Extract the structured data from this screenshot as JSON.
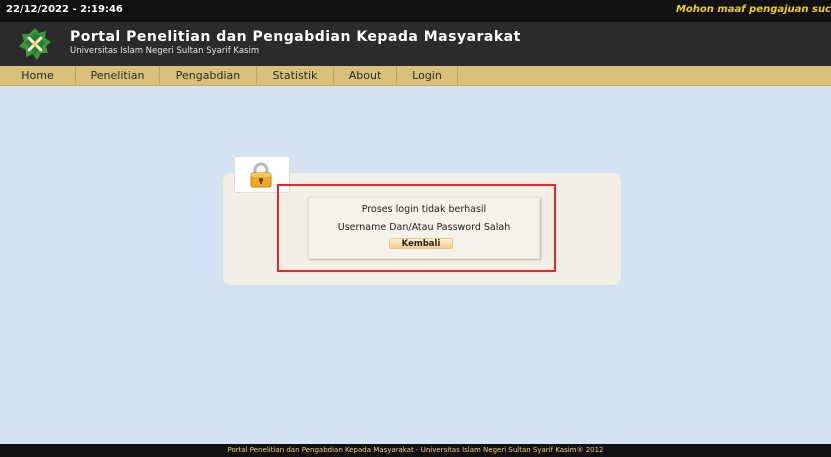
{
  "topbar": {
    "datetime": "22/12/2022 - 2:19:46",
    "marquee": "Mohon maaf pengajuan suc"
  },
  "header": {
    "title": "Portal Penelitian dan Pengabdian Kepada Masyarakat",
    "subtitle": "Universitas Islam Negeri Sultan Syarif Kasim",
    "logo_icon": "uin-suska-logo-icon"
  },
  "nav": {
    "items": [
      {
        "label": "Home"
      },
      {
        "label": "Penelitian"
      },
      {
        "label": "Pengabdian"
      },
      {
        "label": "Statistik"
      },
      {
        "label": "About"
      },
      {
        "label": "Login"
      }
    ]
  },
  "login_result": {
    "icon": "padlock-icon",
    "message": "Proses login tidak berhasil",
    "detail": "Username Dan/Atau Password Salah",
    "back_button": "Kembali"
  },
  "footer": {
    "text": "Portal Penelitian dan Pengabdian Kepada Masyarakat - Universitas Islam Negeri Sultan Syarif Kasim® 2012"
  },
  "colors": {
    "topbar": "#111111",
    "header": "#2b2b2b",
    "nav": "#d8c07a",
    "content_background": "#d3e3f1",
    "marquee_text": "#f0d000",
    "highlight_border": "#e5262b"
  }
}
